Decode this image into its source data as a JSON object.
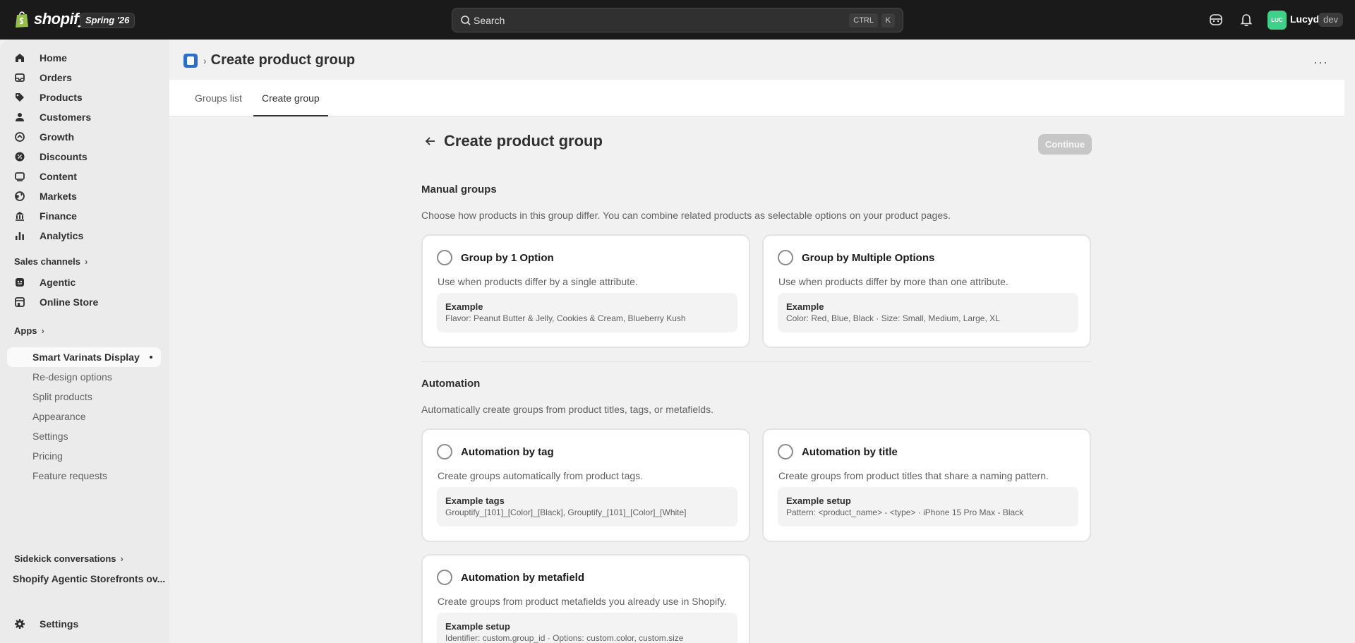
{
  "topbar": {
    "logo_text": "shopify",
    "edition": "Spring '26",
    "search_placeholder": "Search",
    "shortcut_ctrl": "CTRL",
    "shortcut_k": "K",
    "user_initials": "LUC",
    "user_name": "Lucyd",
    "user_badge": "dev"
  },
  "sidebar": {
    "items": [
      {
        "label": "Home",
        "icon": "home-icon"
      },
      {
        "label": "Orders",
        "icon": "inbox-icon"
      },
      {
        "label": "Products",
        "icon": "tag-icon"
      },
      {
        "label": "Customers",
        "icon": "person-icon"
      },
      {
        "label": "Growth",
        "icon": "growth-icon"
      },
      {
        "label": "Discounts",
        "icon": "discount-icon"
      },
      {
        "label": "Content",
        "icon": "image-icon"
      },
      {
        "label": "Markets",
        "icon": "globe-icon"
      },
      {
        "label": "Finance",
        "icon": "bank-icon"
      },
      {
        "label": "Analytics",
        "icon": "bar-chart-icon"
      }
    ],
    "sales_channels_label": "Sales channels",
    "channels": [
      {
        "label": "Agentic",
        "icon": "agentic-icon"
      },
      {
        "label": "Online Store",
        "icon": "store-icon"
      }
    ],
    "apps_label": "Apps",
    "app_items": [
      {
        "label": "Smart Varinats Display"
      },
      {
        "label": "Re-design options"
      },
      {
        "label": "Split products"
      },
      {
        "label": "Appearance"
      },
      {
        "label": "Settings"
      },
      {
        "label": "Pricing"
      },
      {
        "label": "Feature requests"
      }
    ],
    "sidekick_label": "Sidekick conversations",
    "sidekick_item": "Shopify Agentic Storefronts ov...",
    "settings_label": "Settings"
  },
  "header": {
    "app_title": "Create product group",
    "more_label": "···"
  },
  "tabs": [
    {
      "label": "Groups list",
      "active": false
    },
    {
      "label": "Create group",
      "active": true
    }
  ],
  "page": {
    "title": "Create product group",
    "continue_label": "Continue",
    "manual": {
      "title": "Manual groups",
      "description": "Choose how products in this group differ. You can combine related products as selectable options on your product pages.",
      "cards": [
        {
          "title": "Group by 1 Option",
          "description": "Use when products differ by a single attribute.",
          "example_title": "Example",
          "example_text": "Flavor: Peanut Butter & Jelly, Cookies & Cream, Blueberry Kush"
        },
        {
          "title": "Group by Multiple Options",
          "description": "Use when products differ by more than one attribute.",
          "example_title": "Example",
          "example_text": "Color: Red, Blue, Black · Size: Small, Medium, Large, XL"
        }
      ]
    },
    "automation": {
      "title": "Automation",
      "description": "Automatically create groups from product titles, tags, or metafields.",
      "cards": [
        {
          "title": "Automation by tag",
          "description": "Create groups automatically from product tags.",
          "example_title": "Example tags",
          "example_text": "Grouptify_[101]_[Color]_[Black], Grouptify_[101]_[Color]_[White]"
        },
        {
          "title": "Automation by title",
          "description": "Create groups from product titles that share a naming pattern.",
          "example_title": "Example setup",
          "example_text": "Pattern: <product_name> - <type> · iPhone 15 Pro Max - Black"
        },
        {
          "title": "Automation by metafield",
          "description": "Create groups from product metafields you already use in Shopify.",
          "example_title": "Example setup",
          "example_text": "Identifier: custom.group_id · Options: custom.color, custom.size"
        }
      ]
    }
  },
  "colors": {
    "topbar": "#1a1a1a",
    "accent_avatar": "#3fd18a",
    "disabled_button": "#c7c7c7"
  }
}
